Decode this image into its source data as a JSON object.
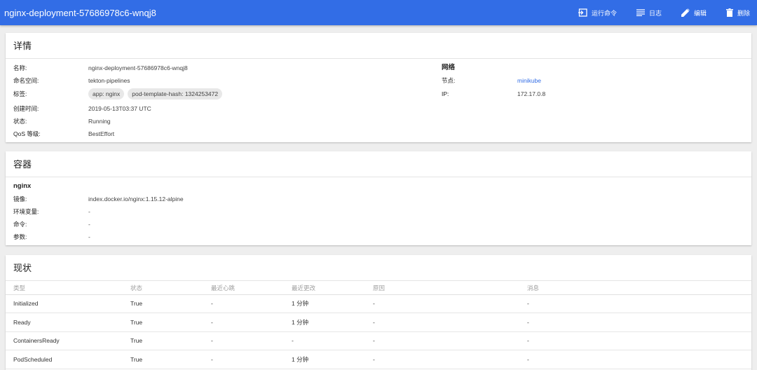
{
  "header": {
    "title": "nginx-deployment-57686978c6-wnqj8",
    "actions": [
      {
        "label": "运行命令",
        "icon": "exec-icon"
      },
      {
        "label": "日志",
        "icon": "logs-icon"
      },
      {
        "label": "编辑",
        "icon": "edit-icon"
      },
      {
        "label": "删除",
        "icon": "delete-icon"
      }
    ]
  },
  "details": {
    "title": "详情",
    "name_label": "名称:",
    "name": "nginx-deployment-57686978c6-wnqj8",
    "namespace_label": "命名空间:",
    "namespace": "tekton-pipelines",
    "labels_label": "标签:",
    "labels": [
      "app: nginx",
      "pod-template-hash: 1324253472"
    ],
    "created_label": "创建时间:",
    "created": "2019-05-13T03:37 UTC",
    "status_label": "状态:",
    "status": "Running",
    "qos_label": "QoS 等级:",
    "qos": "BestEffort",
    "network_title": "网络",
    "node_label": "节点:",
    "node": "minikube",
    "ip_label": "IP:",
    "ip": "172.17.0.8"
  },
  "containers": {
    "title": "容器",
    "name": "nginx",
    "image_label": "镜像:",
    "image": "index.docker.io/nginx:1.15.12-alpine",
    "env_label": "环境变量:",
    "env": "-",
    "cmd_label": "命令:",
    "cmd": "-",
    "args_label": "参数:",
    "args": "-"
  },
  "conditions": {
    "title": "现状",
    "columns": [
      "类型",
      "状态",
      "最近心跳",
      "最近更改",
      "原因",
      "消息"
    ],
    "rows": [
      [
        "Initialized",
        "True",
        "-",
        "1 分钟",
        "-",
        "-"
      ],
      [
        "Ready",
        "True",
        "-",
        "1 分钟",
        "-",
        "-"
      ],
      [
        "ContainersReady",
        "True",
        "-",
        "-",
        "-",
        "-"
      ],
      [
        "PodScheduled",
        "True",
        "-",
        "1 分钟",
        "-",
        "-"
      ]
    ]
  }
}
